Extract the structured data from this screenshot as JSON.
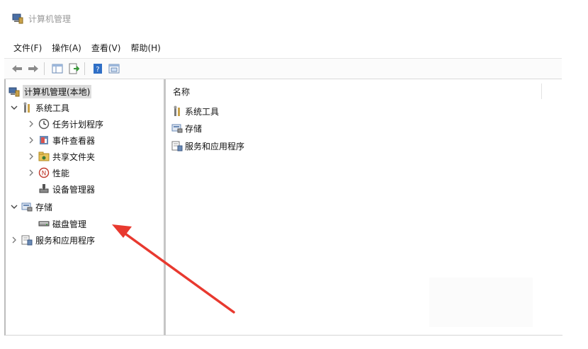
{
  "window": {
    "title": "计算机管理"
  },
  "menu": [
    {
      "label": "文件(F)"
    },
    {
      "label": "操作(A)"
    },
    {
      "label": "查看(V)"
    },
    {
      "label": "帮助(H)"
    }
  ],
  "toolbar": {
    "buttons": [
      "back-arrow-icon",
      "forward-arrow-icon",
      "show-hide-tree-icon",
      "export-list-icon",
      "help-icon",
      "properties-icon"
    ]
  },
  "tree": {
    "root": "计算机管理(本地)",
    "system_tools": "系统工具",
    "task_scheduler": "任务计划程序",
    "event_viewer": "事件查看器",
    "shared_folders": "共享文件夹",
    "performance": "性能",
    "device_manager": "设备管理器",
    "storage": "存储",
    "disk_management": "磁盘管理",
    "services_apps": "服务和应用程序"
  },
  "list": {
    "column_name": "名称",
    "items": [
      "系统工具",
      "存储",
      "服务和应用程序"
    ]
  },
  "colors": {
    "arrow": "#e8392f",
    "selection": "#dcdcdc"
  }
}
